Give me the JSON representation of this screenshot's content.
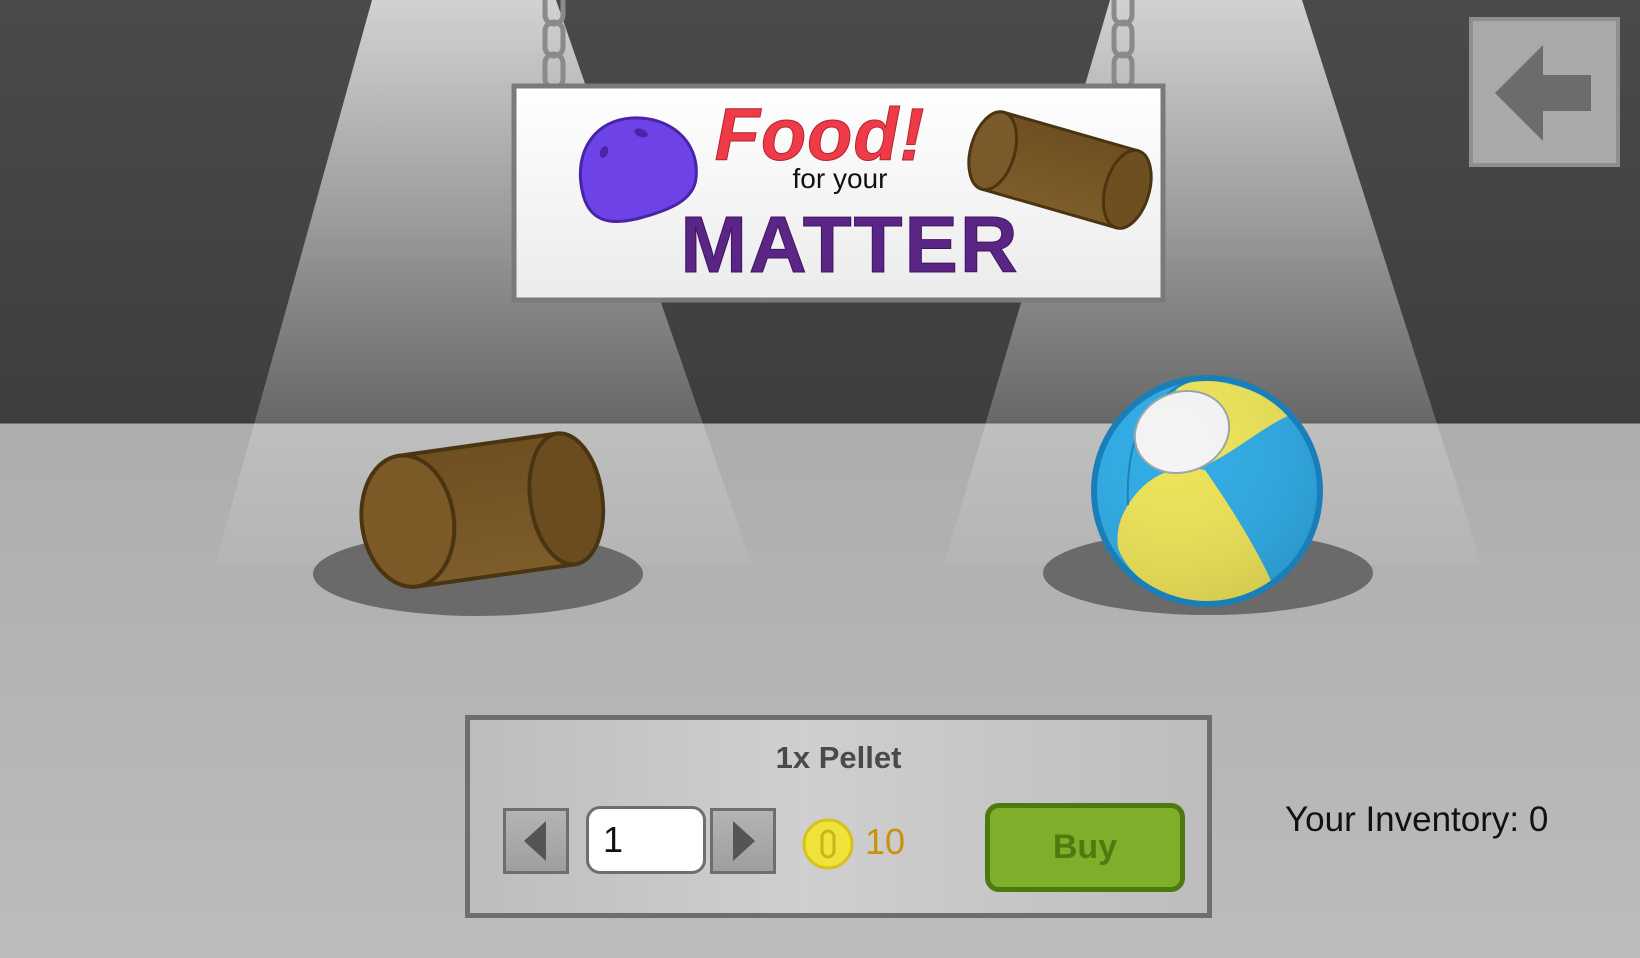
{
  "sign": {
    "title": "Food!",
    "subtitle": "for your",
    "matter": "MATTER"
  },
  "shop": {
    "item_name": "1x Pellet",
    "quantity": "1",
    "price": "10",
    "buy_label": "Buy"
  },
  "inventory_text": "Your Inventory: 0",
  "icons": {
    "back": "arrow-left-icon",
    "decrement": "triangle-left-icon",
    "increment": "triangle-right-icon",
    "currency": "coin-icon"
  },
  "colors": {
    "wall": "#454545",
    "floor": "#b4b4b4",
    "buy_button": "#7fae2b",
    "price": "#c9920c",
    "title_red": "#ef3b47",
    "matter_purple": "#5a2585"
  }
}
